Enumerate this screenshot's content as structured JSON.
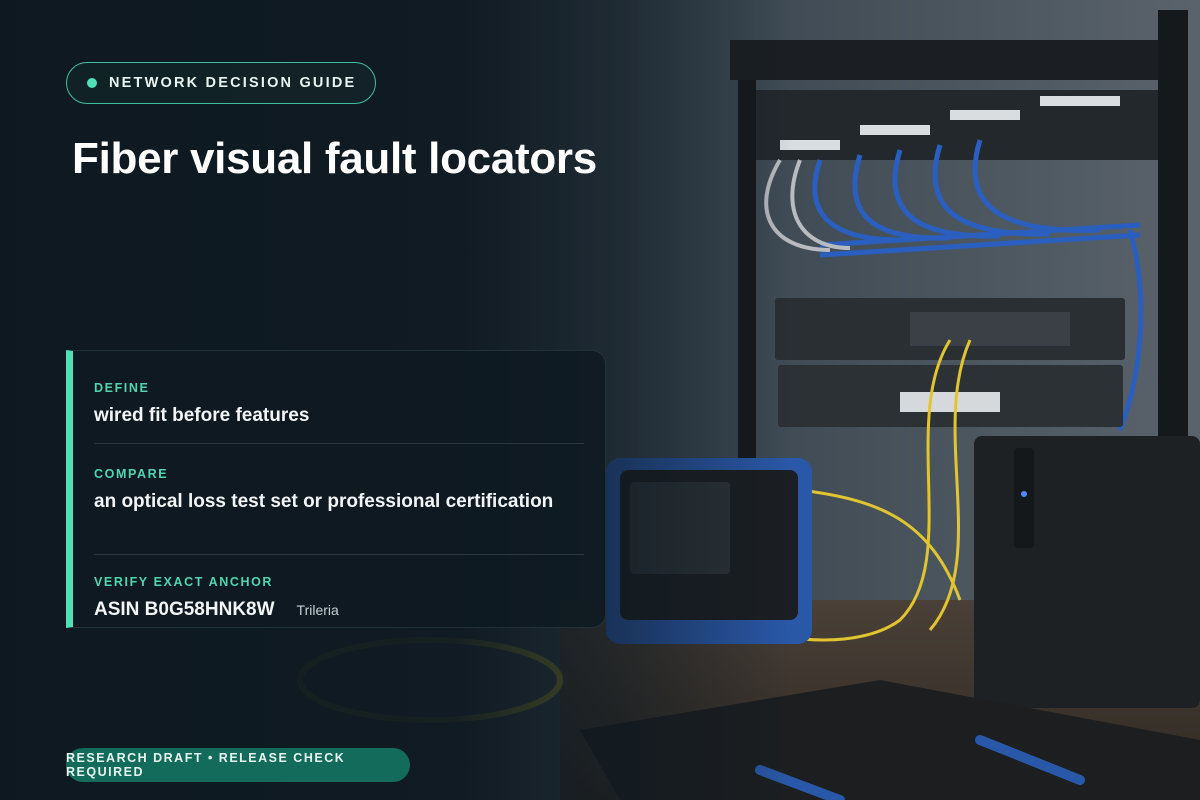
{
  "badge": {
    "label": "NETWORK DECISION GUIDE"
  },
  "title": "Fiber visual fault locators",
  "card": {
    "define": {
      "label": "DEFINE",
      "value": "wired fit before features"
    },
    "compare": {
      "label": "COMPARE",
      "value": "an optical loss test set or professional certification"
    },
    "verify": {
      "label": "VERIFY EXACT ANCHOR",
      "value": "ASIN B0G58HNK8W",
      "brand": "Trileria"
    }
  },
  "footer": {
    "label": "RESEARCH DRAFT • RELEASE CHECK REQUIRED"
  },
  "colors": {
    "accent": "#4fe0b5",
    "background": "#0f1a22",
    "footer_bg": "#136b5c"
  }
}
